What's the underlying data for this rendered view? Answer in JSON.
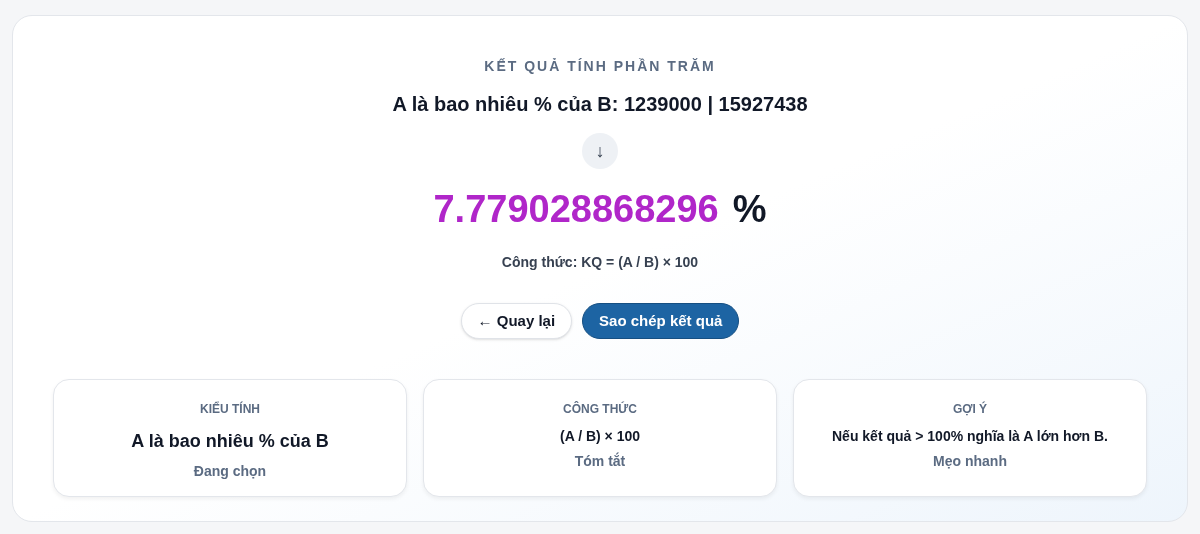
{
  "eyebrow": "KẾT QUẢ TÍNH PHẦN TRĂM",
  "title": "A là bao nhiêu % của B: 1239000 | 15927438",
  "arrow": "↓",
  "result": {
    "value": "7.779028868296",
    "unit": "%"
  },
  "formula": "Công thức: KQ = (A / B) × 100",
  "buttons": [
    {
      "label": "← Quay lại",
      "kind": "secondary"
    },
    {
      "label": "Sao chép kết quả",
      "kind": "primary"
    }
  ],
  "cards": [
    {
      "heading": "KIỂU TÍNH",
      "value": "A là bao nhiêu % của B",
      "note": "Đang chọn",
      "kind": "large"
    },
    {
      "heading": "CÔNG THỨC",
      "value": "(A / B) × 100",
      "note": "Tóm tắt",
      "kind": "small"
    },
    {
      "heading": "GỢI Ý",
      "value": "Nếu kết quả > 100% nghĩa là A lớn hơn B.",
      "note": "Mẹo nhanh",
      "kind": "small"
    }
  ]
}
